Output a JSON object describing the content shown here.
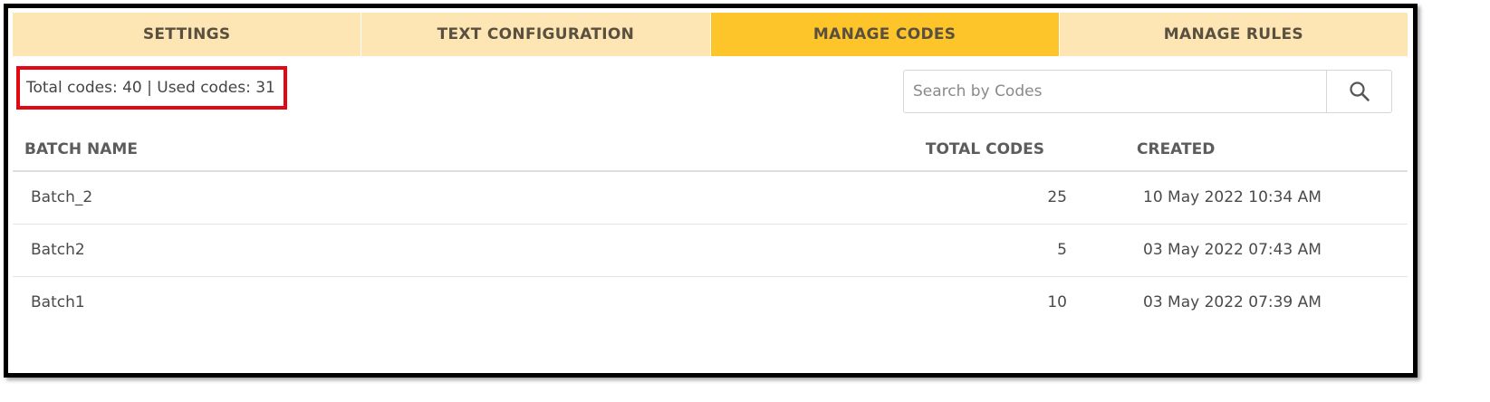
{
  "tabs": [
    {
      "label": "SETTINGS",
      "active": false
    },
    {
      "label": "TEXT CONFIGURATION",
      "active": false
    },
    {
      "label": "MANAGE CODES",
      "active": true
    },
    {
      "label": "MANAGE RULES",
      "active": false
    }
  ],
  "summary": {
    "text": "Total codes: 40 | Used codes: 31",
    "highlight_color": "#e30613"
  },
  "search": {
    "placeholder": "Search by Codes",
    "value": "",
    "icon": "search-icon"
  },
  "table": {
    "headers": {
      "batch_name": "BATCH NAME",
      "total_codes": "TOTAL CODES",
      "created": "CREATED"
    },
    "rows": [
      {
        "batch_name": "Batch_2",
        "total_codes": "25",
        "created": "10 May 2022 10:34 AM"
      },
      {
        "batch_name": "Batch2",
        "total_codes": "5",
        "created": "03 May 2022 07:43 AM"
      },
      {
        "batch_name": "Batch1",
        "total_codes": "10",
        "created": "03 May 2022 07:39 AM"
      }
    ]
  },
  "colors": {
    "tab_background": "#fde6b4",
    "tab_active": "#fdc52a",
    "frame_border": "#000000"
  }
}
